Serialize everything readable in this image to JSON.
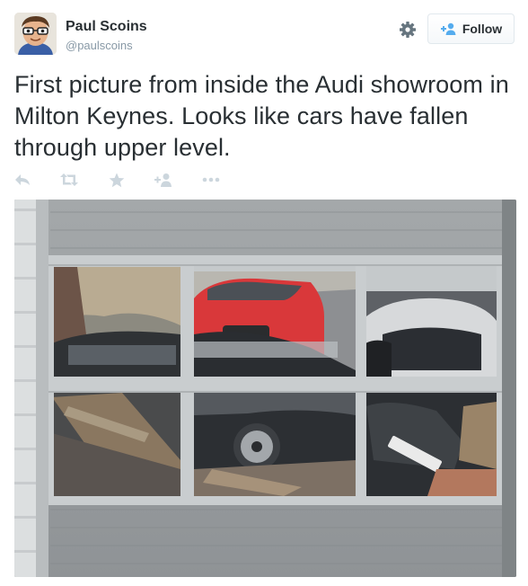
{
  "tweet": {
    "author_name": "Paul Scoins",
    "author_handle": "@paulscoins",
    "follow_label": "Follow",
    "text": "First picture from inside the Audi showroom in Milton Keynes. Looks like cars have fallen through upper level."
  },
  "icons": {
    "settings": "gear-icon",
    "follow": "add-user-icon",
    "reply": "reply-icon",
    "retweet": "retweet-icon",
    "favorite": "star-icon",
    "follow_action": "add-user-icon",
    "more": "ellipsis-icon"
  },
  "colors": {
    "text": "#292f33",
    "muted": "#8899a6",
    "action_icons": "#ccd6dd",
    "button_border": "#e1e8ed"
  }
}
